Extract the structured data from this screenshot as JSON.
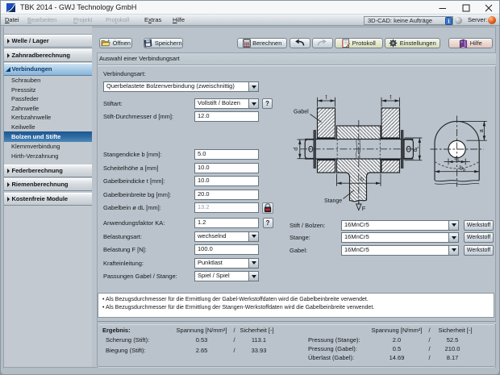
{
  "window": {
    "title": "TBK 2014 - GWJ Technology GmbH"
  },
  "menu": {
    "items": [
      {
        "pre": "",
        "acc": "D",
        "post": "atei",
        "enabled": true
      },
      {
        "pre": "",
        "acc": "B",
        "post": "earbeiten",
        "enabled": false
      },
      {
        "pre": "",
        "acc": "P",
        "post": "rojekt",
        "enabled": false
      },
      {
        "pre": "Pro",
        "acc": "t",
        "post": "okoll",
        "enabled": false
      },
      {
        "pre": "E",
        "acc": "x",
        "post": "tras",
        "enabled": true
      },
      {
        "pre": "",
        "acc": "H",
        "post": "ilfe",
        "enabled": true
      }
    ],
    "cad_status": "3D-CAD: keine Aufträge",
    "server_label": "Server:"
  },
  "toolbar": {
    "open": "Öffnen",
    "save": "Speichern",
    "calculate": "Berechnen",
    "protocol": "Protokoll",
    "settings": "Einstellungen",
    "help": "Hilfe"
  },
  "sidebar": {
    "groups": [
      {
        "label": "Welle / Lager",
        "state": "collapsed"
      },
      {
        "label": "Zahnradberechnung",
        "state": "collapsed"
      },
      {
        "label": "Verbindungen",
        "state": "expanded"
      },
      {
        "label": "Federberechnung",
        "state": "collapsed"
      },
      {
        "label": "Riemenberechnung",
        "state": "collapsed"
      },
      {
        "label": "Kostenfreie Module",
        "state": "collapsed"
      }
    ],
    "items": [
      {
        "label": "Schrauben"
      },
      {
        "label": "Presssitz"
      },
      {
        "label": "Passfeder"
      },
      {
        "label": "Zahnwelle"
      },
      {
        "label": "Kerbzahnwelle"
      },
      {
        "label": "Keilwelle"
      },
      {
        "label": "Bolzen und Stifte",
        "selected": true
      },
      {
        "label": "Klemmverbindung"
      },
      {
        "label": "Hirth-Verzahnung"
      }
    ]
  },
  "content": {
    "section_title": "Auswahl einer Verbindungsart",
    "form": {
      "verbindungsart": {
        "label": "Verbindungsart:",
        "value": "Querbelastete Bolzenverbindung (zweischnittig)"
      },
      "stiftart": {
        "label": "Stiftart:",
        "value": "Vollstift / Bolzen",
        "help": "?"
      },
      "stift_durchmesser": {
        "label": "Stift-Durchmesser d [mm]:",
        "value": "12.0"
      },
      "stangendicke": {
        "label": "Stangendicke b [mm]:",
        "value": "5.0"
      },
      "scheitelhoehe": {
        "label": "Scheitelhöhe a [mm]",
        "value": "10.0"
      },
      "gabelbeindicke": {
        "label": "Gabelbeindicke t [mm]:",
        "value": "10.0"
      },
      "gabelbeinbreite": {
        "label": "Gabelbeinbreite bg [mm]:",
        "value": "20.0"
      },
      "gabelbein_dl": {
        "label": "Gabelbein ø dL [mm]:",
        "value": "13.2",
        "locked": true
      },
      "anwendungsfaktor": {
        "label": "Anwendungsfaktor KA:",
        "value": "1.2",
        "help": "?"
      },
      "belastungsart": {
        "label": "Belastungsart:",
        "value": "wechselnd"
      },
      "belastung": {
        "label": "Belastung F [N]:",
        "value": "100.0"
      },
      "krafteinleitung": {
        "label": "Krafteinleitung:",
        "value": "Punktlast"
      },
      "passungen": {
        "label": "Passungen Gabel / Stange:",
        "value": "Spiel / Spiel"
      }
    },
    "materials": {
      "button_label": "Werkstoff",
      "rows": [
        {
          "label": "Stift / Bolzen:",
          "value": "16MnCr5"
        },
        {
          "label": "Stange:",
          "value": "16MnCr5"
        },
        {
          "label": "Gabel:",
          "value": "16MnCr5"
        }
      ]
    },
    "notes": [
      "Als Bezugsdurchmesser für die Ermittlung der Gabel-Werkstoffdaten wird die Gabelbeinbreite verwendet.",
      "Als Bezugsdurchmesser für die Ermittlung der Stangen-Werkstoffdaten wird die Gabelbeinbreite verwendet."
    ],
    "results": {
      "title": "Ergebnis:",
      "col_spannung": "Spannung [N/mm²]",
      "col_slash": "/",
      "col_sicherheit": "Sicherheit [-]",
      "left_rows": [
        {
          "label": "Scherung (Stift):",
          "spannung": "0.53",
          "sicherheit": "113.1"
        },
        {
          "label": "Biegung (Stift):",
          "spannung": "2.65",
          "sicherheit": "33.93"
        }
      ],
      "right_rows": [
        {
          "label": "Pressung (Stange):",
          "spannung": "2.0",
          "sicherheit": "52.5"
        },
        {
          "label": "Pressung (Gabel):",
          "spannung": "0.5",
          "sicherheit": "210.0"
        },
        {
          "label": "Überlast (Gabel):",
          "spannung": "14.69",
          "sicherheit": "8.17"
        }
      ]
    }
  },
  "drawing": {
    "gabel": "Gabel",
    "stange": "Stange",
    "dim_t_left": "t",
    "dim_t_right": "t",
    "dim_d": "d",
    "dim_dl_main": "d",
    "dim_dl_sub": "L",
    "dim_b": "b",
    "force": "F",
    "dim_a": "a",
    "dim_bg_main": "b",
    "dim_bg_sub": "g"
  }
}
